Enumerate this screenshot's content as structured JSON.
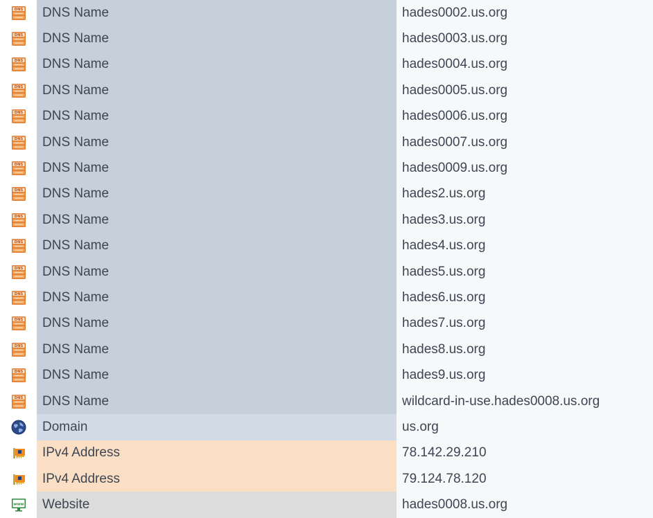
{
  "colors": {
    "dns": "#c6d0da",
    "domain": "#d3dce6",
    "ipv4": "#fadfc4",
    "website": "#dcdcdc",
    "value_bg": "#f7f8fa"
  },
  "rows": [
    {
      "kind": "dns",
      "icon": "dns-server-icon",
      "type": "DNS Name",
      "value": "hades0002.us.org"
    },
    {
      "kind": "dns",
      "icon": "dns-server-icon",
      "type": "DNS Name",
      "value": "hades0003.us.org"
    },
    {
      "kind": "dns",
      "icon": "dns-server-icon",
      "type": "DNS Name",
      "value": "hades0004.us.org"
    },
    {
      "kind": "dns",
      "icon": "dns-server-icon",
      "type": "DNS Name",
      "value": "hades0005.us.org"
    },
    {
      "kind": "dns",
      "icon": "dns-server-icon",
      "type": "DNS Name",
      "value": "hades0006.us.org"
    },
    {
      "kind": "dns",
      "icon": "dns-server-icon",
      "type": "DNS Name",
      "value": "hades0007.us.org"
    },
    {
      "kind": "dns",
      "icon": "dns-server-icon",
      "type": "DNS Name",
      "value": "hades0009.us.org"
    },
    {
      "kind": "dns",
      "icon": "dns-server-icon",
      "type": "DNS Name",
      "value": "hades2.us.org"
    },
    {
      "kind": "dns",
      "icon": "dns-server-icon",
      "type": "DNS Name",
      "value": "hades3.us.org"
    },
    {
      "kind": "dns",
      "icon": "dns-server-icon",
      "type": "DNS Name",
      "value": "hades4.us.org"
    },
    {
      "kind": "dns",
      "icon": "dns-server-icon",
      "type": "DNS Name",
      "value": "hades5.us.org"
    },
    {
      "kind": "dns",
      "icon": "dns-server-icon",
      "type": "DNS Name",
      "value": "hades6.us.org"
    },
    {
      "kind": "dns",
      "icon": "dns-server-icon",
      "type": "DNS Name",
      "value": "hades7.us.org"
    },
    {
      "kind": "dns",
      "icon": "dns-server-icon",
      "type": "DNS Name",
      "value": "hades8.us.org"
    },
    {
      "kind": "dns",
      "icon": "dns-server-icon",
      "type": "DNS Name",
      "value": "hades9.us.org"
    },
    {
      "kind": "dns",
      "icon": "dns-server-icon",
      "type": "DNS Name",
      "value": "wildcard-in-use.hades0008.us.org"
    },
    {
      "kind": "domain",
      "icon": "globe-icon",
      "type": "Domain",
      "value": "us.org"
    },
    {
      "kind": "ipv4",
      "icon": "network-card-icon",
      "type": "IPv4 Address",
      "value": "78.142.29.210"
    },
    {
      "kind": "ipv4",
      "icon": "network-card-icon",
      "type": "IPv4 Address",
      "value": "79.124.78.120"
    },
    {
      "kind": "website",
      "icon": "www-monitor-icon",
      "type": "Website",
      "value": "hades0008.us.org"
    }
  ]
}
